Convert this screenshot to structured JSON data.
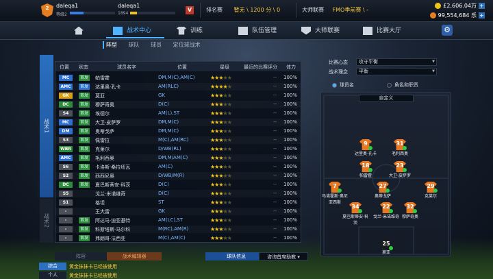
{
  "player": {
    "name": "daleqa1",
    "level": "等级2",
    "name2": "daleqa1",
    "value2": "1894",
    "xp_fraction": 0.3,
    "xp2_fraction": 0.15,
    "crest_text": "2"
  },
  "top": {
    "vbadge": "V",
    "rank_label": "排名赛",
    "rank_value": "暂无 \\ 1200 分 \\ 0",
    "league_label": "大师联赛",
    "league_value": "FMO季前赛 \\ -",
    "money1": "£2,606.04万",
    "money2": "99,554,684 乐"
  },
  "nav": {
    "items": [
      "",
      "战术中心",
      "训练",
      "队伍管理",
      "大师联赛",
      "比赛大厅"
    ]
  },
  "subtabs": [
    "阵型",
    "球队",
    "球员",
    "定位球战术"
  ],
  "vtabs": [
    "战术1",
    "战术2"
  ],
  "table": {
    "headers": [
      "位置",
      "状态",
      "球员名字",
      "位置",
      "星级",
      "最近的比赛评分",
      "体力"
    ],
    "rows": [
      {
        "pos": "MC",
        "pcolor": "#2f6fd0",
        "status": "首发",
        "scolor": "#2e8b3a",
        "name": "帕雷霍",
        "positions": "DM,M(C),AM(C)",
        "stars": 3,
        "rating": "--",
        "stamina": "100%"
      },
      {
        "pos": "AMC",
        "pcolor": "#2f6fd0",
        "status": "首发",
        "scolor": "#2f6fd0",
        "name": "达里奥·孔卡",
        "positions": "AM(RLC)",
        "stars": 4,
        "rating": "--",
        "stamina": "100%"
      },
      {
        "pos": "GK",
        "pcolor": "#d4a017",
        "status": "首发",
        "scolor": "#2e8b3a",
        "name": "莫亚",
        "positions": "GK",
        "stars": 3,
        "rating": "--",
        "stamina": "100%"
      },
      {
        "pos": "DC",
        "pcolor": "#2e8b3a",
        "status": "首发",
        "scolor": "#2e8b3a",
        "name": "穆萨奇奥",
        "positions": "D(C)",
        "stars": 3,
        "rating": "--",
        "stamina": "100%"
      },
      {
        "pos": "S4",
        "pcolor": "#4a4f58",
        "status": "首发",
        "scolor": "#2e8b3a",
        "name": "埃德尔",
        "positions": "AM(L),ST",
        "stars": 3,
        "rating": "--",
        "stamina": "100%"
      },
      {
        "pos": "MC",
        "pcolor": "#2f6fd0",
        "status": "首发",
        "scolor": "#2e8b3a",
        "name": "大卫·皮萨罗",
        "positions": "DM,M(C)",
        "stars": 3,
        "rating": "--",
        "stamina": "100%"
      },
      {
        "pos": "DM",
        "pcolor": "#2f6fd0",
        "status": "首发",
        "scolor": "#2e8b3a",
        "name": "奥蒂戈萨",
        "positions": "DM,M(C)",
        "stars": 3,
        "rating": "--",
        "stamina": "100%"
      },
      {
        "pos": "S3",
        "pcolor": "#4a4f58",
        "status": "首发",
        "scolor": "#2e8b3a",
        "name": "佩雷拉",
        "positions": "M(C),AM(RC)",
        "stars": 3,
        "rating": "--",
        "stamina": "100%"
      },
      {
        "pos": "WBR",
        "pcolor": "#2e8b3a",
        "status": "首发",
        "scolor": "#2e8b3a",
        "name": "克莱尔",
        "positions": "D/WB(RL)",
        "stars": 3,
        "rating": "--",
        "stamina": "100%"
      },
      {
        "pos": "AMC",
        "pcolor": "#2f6fd0",
        "status": "首发",
        "scolor": "#2e8b3a",
        "name": "毛利西奥",
        "positions": "DM,M/AM(C)",
        "stars": 3,
        "rating": "--",
        "stamina": "100%"
      },
      {
        "pos": "S6",
        "pcolor": "#4a4f58",
        "status": "首发",
        "scolor": "#2e8b3a",
        "name": "卡洛斯·桑拉纽瓦",
        "positions": "AM(C)",
        "stars": 3,
        "rating": "--",
        "stamina": "100%"
      },
      {
        "pos": "S2",
        "pcolor": "#4a4f58",
        "status": "首发",
        "scolor": "#2e8b3a",
        "name": "西西尼奥",
        "positions": "D/WB/M(R)",
        "stars": 3,
        "rating": "--",
        "stamina": "100%"
      },
      {
        "pos": "DC",
        "pcolor": "#2e8b3a",
        "status": "首发",
        "scolor": "#2e8b3a",
        "name": "夏巴斯蒂安·科茨",
        "positions": "D(C)",
        "stars": 3,
        "rating": "--",
        "stamina": "100%"
      },
      {
        "pos": "S5",
        "pcolor": "#4a4f58",
        "status": "",
        "scolor": "#2e8b3a",
        "name": "戈兰·米诺维奇",
        "positions": "D(C)",
        "stars": 3,
        "rating": "--",
        "stamina": "100%"
      },
      {
        "pos": "S1",
        "pcolor": "#4a4f58",
        "status": "",
        "scolor": "#2e8b3a",
        "name": "格坦",
        "positions": "ST",
        "stars": 3,
        "rating": "--",
        "stamina": "100%"
      },
      {
        "pos": "-",
        "pcolor": "#4a4f58",
        "status": "",
        "scolor": "#2e8b3a",
        "name": "王大雷",
        "positions": "GK",
        "stars": 3,
        "rating": "--",
        "stamina": "100%"
      },
      {
        "pos": "-",
        "pcolor": "#4a4f58",
        "status": "首发",
        "scolor": "#2e8b3a",
        "name": "阿达马·迪亚基特",
        "positions": "AM(LC),ST",
        "stars": 3,
        "rating": "--",
        "stamina": "100%"
      },
      {
        "pos": "-",
        "pcolor": "#4a4f58",
        "status": "首发",
        "scolor": "#2e8b3a",
        "name": "科斯塔斯·马尔科",
        "positions": "M(RC),AM(R)",
        "stars": 3,
        "rating": "--",
        "stamina": "100%"
      },
      {
        "pos": "-",
        "pcolor": "#4a4f58",
        "status": "首发",
        "scolor": "#2e8b3a",
        "name": "弗朗哥·法西亚",
        "positions": "M(C),AM(C)",
        "stars": 3,
        "rating": "--",
        "stamina": "100%"
      }
    ]
  },
  "right": {
    "mentality_label": "比赛心态",
    "mentality_value": "攻守平衡",
    "philosophy_label": "战术理念",
    "philosophy_value": "平衡",
    "opt1": "球员名",
    "opt2": "角色和职责",
    "formation": "自定义"
  },
  "pitch_players": [
    {
      "num": "9",
      "name": "达里奥·孔卡",
      "gk": false
    },
    {
      "num": "31",
      "name": "毛利西奥",
      "gk": false
    },
    {
      "num": "18",
      "name": "帕雷霍",
      "gk": false
    },
    {
      "num": "23",
      "name": "大卫·皮萨罗",
      "gk": false
    },
    {
      "num": "7",
      "name": "马诺霍斯·奥尼亚西斯",
      "gk": false
    },
    {
      "num": "27",
      "name": "奥蒂戈萨",
      "gk": false
    },
    {
      "num": "29",
      "name": "克莱尔",
      "gk": false
    },
    {
      "num": "34",
      "name": "夏巴斯蒂安·科茨",
      "gk": false
    },
    {
      "num": "22",
      "name": "戈兰·米诺维奇",
      "gk": false
    },
    {
      "num": "32",
      "name": "穆萨奇奥",
      "gk": false
    },
    {
      "num": "25",
      "name": "莫亚",
      "gk": true
    }
  ],
  "bottom": {
    "tab1": "阵容",
    "tab2": "战术编辑器",
    "tab3": "球队信息",
    "tab4": "咨询首席助教"
  },
  "chat": {
    "label1": "综合",
    "label2": "个人",
    "msg1": "黄金抹抹卡已经被使用",
    "msg2": "黄金抹抹卡已经被使用"
  }
}
